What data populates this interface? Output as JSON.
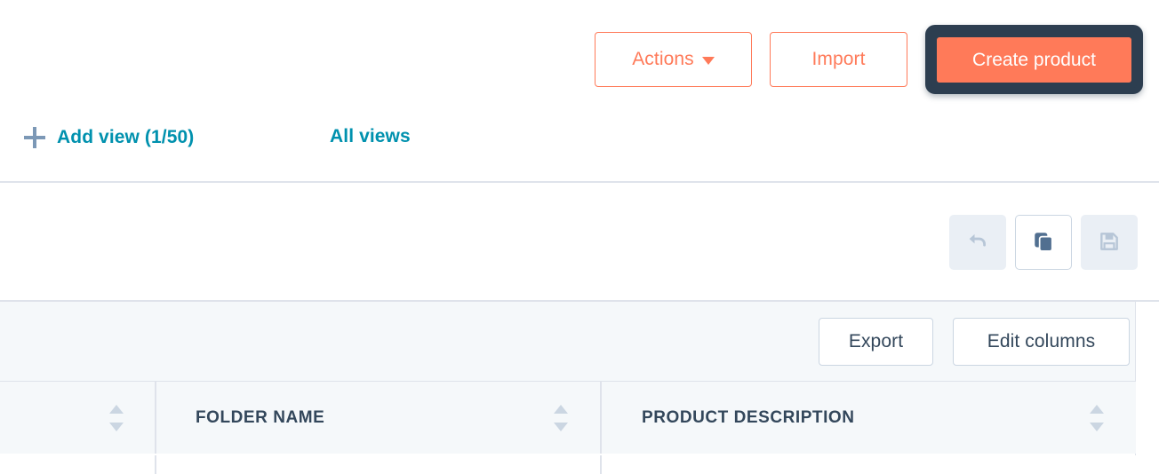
{
  "top_actions": {
    "actions_label": "Actions",
    "import_label": "Import",
    "create_product_label": "Create product",
    "accent_color": "#ff7a59",
    "highlight_color": "#2d3e50"
  },
  "views_row": {
    "add_view_label": "Add view (1/50)",
    "all_views_label": "All views",
    "link_color": "#0091ae",
    "plus_icon_color": "#7c98b6"
  },
  "icon_toolbar": {
    "undo_icon": "undo-icon",
    "copy_icon": "copy-icon",
    "save_icon": "save-icon",
    "undo_state": "disabled",
    "copy_state": "active",
    "save_state": "disabled",
    "disabled_bg": "#eaeff5",
    "icon_color_active": "#516f90",
    "icon_color_disabled": "#b7c6d7"
  },
  "table_toolbar": {
    "export_label": "Export",
    "edit_columns_label": "Edit columns",
    "band_bg": "#f5f8fa",
    "border_color": "#cbd6e2"
  },
  "table": {
    "columns": [
      {
        "label": "",
        "sortable": true
      },
      {
        "label": "FOLDER NAME",
        "sortable": true
      },
      {
        "label": "PRODUCT DESCRIPTION",
        "sortable": true
      }
    ],
    "header_bg": "#f5f8fa",
    "header_text_color": "#33475b",
    "sort_arrow_color": "#cbd6e2",
    "grid_color": "#dfe3eb"
  }
}
